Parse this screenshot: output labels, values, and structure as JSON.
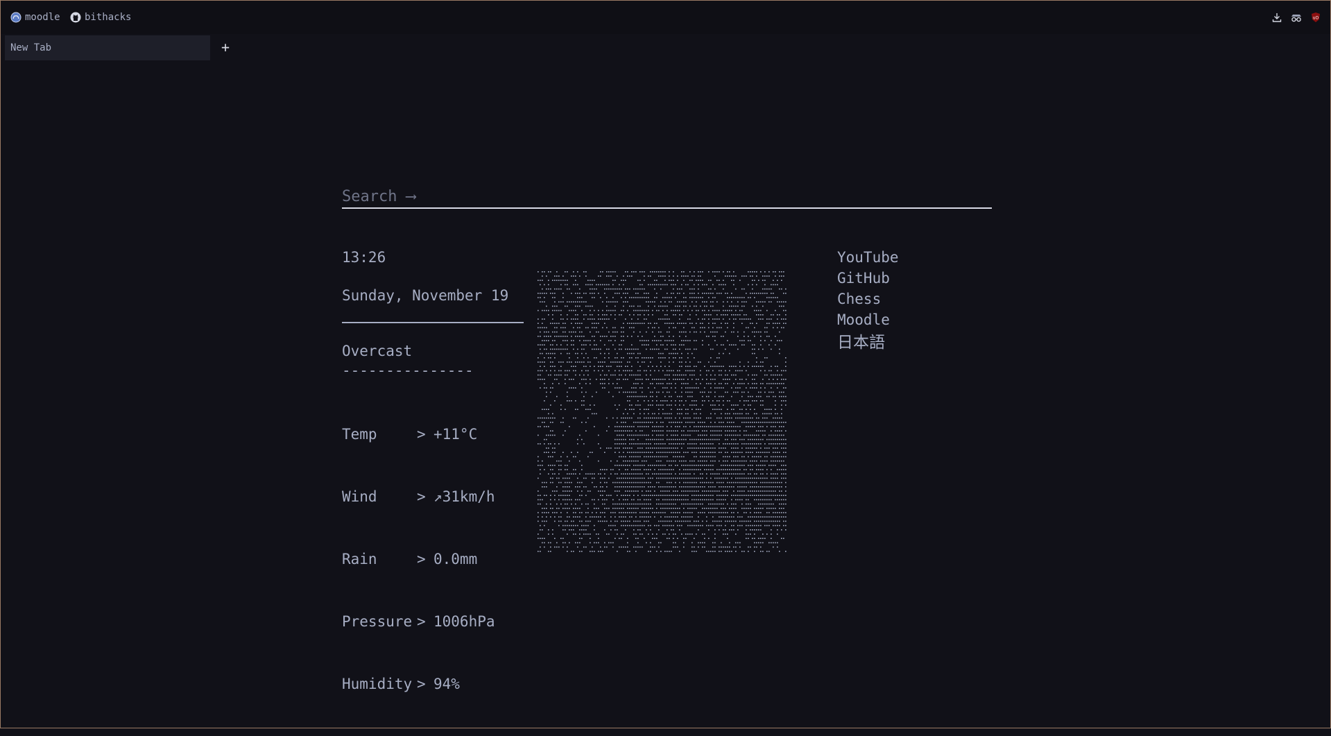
{
  "bookmarks": [
    {
      "label": "moodle",
      "icon": "moodle-icon"
    },
    {
      "label": "bithacks",
      "icon": "github-icon"
    }
  ],
  "toolbar_icons": [
    "download-icon",
    "incognito-icon",
    "ublock-icon"
  ],
  "tabs": [
    {
      "label": "New Tab"
    }
  ],
  "new_tab_label": "+",
  "search": {
    "placeholder": "Search ⟶"
  },
  "clock": "13:26",
  "date": "Sunday, November 19",
  "weather": {
    "condition": "Overcast",
    "dashes": "---------------",
    "rows": [
      {
        "key": "Temp",
        "sep": ">",
        "value": "+11°C"
      },
      {
        "key": "Wind",
        "sep": ">",
        "value": "↗31km/h"
      },
      {
        "key": "Rain",
        "sep": ">",
        "value": "0.0mm"
      },
      {
        "key": "Pressure",
        "sep": ">",
        "value": "1006hPa"
      },
      {
        "key": "Humidity",
        "sep": ">",
        "value": "94%"
      }
    ]
  },
  "art": {
    "icon": "braille-ascii-art",
    "color": "#a7aec4"
  },
  "links": [
    {
      "label": "YouTube"
    },
    {
      "label": "GitHub"
    },
    {
      "label": "Chess"
    },
    {
      "label": "Moodle"
    },
    {
      "label": "日本語"
    }
  ]
}
